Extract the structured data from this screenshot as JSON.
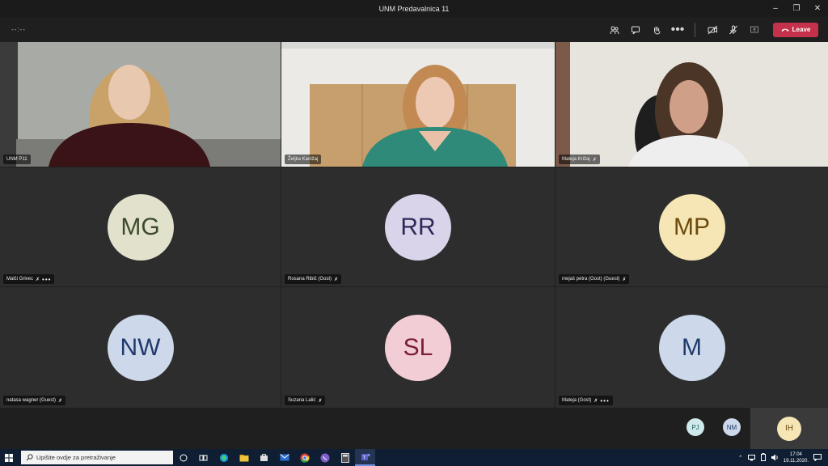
{
  "window": {
    "title": "UNM Predavalnica 11"
  },
  "toolbar": {
    "timer": "--:--",
    "leave_label": "Leave"
  },
  "tiles": [
    {
      "name": "UNM P11",
      "type": "video"
    },
    {
      "name": "Željka Kanižaj",
      "type": "video"
    },
    {
      "name": "Mateja Križaj",
      "type": "video"
    },
    {
      "name": "Malči Grivec",
      "initials": "MG",
      "bg": "#e2e2cc",
      "fg": "#3b4a2a"
    },
    {
      "name": "Rosana Ribič (Gost)",
      "initials": "RR",
      "bg": "#d9d4ea",
      "fg": "#2f2a5a"
    },
    {
      "name": "mejaš petra (Gost) (Guest)",
      "initials": "MP",
      "bg": "#f6e6b6",
      "fg": "#6b4a0c"
    },
    {
      "name": "natasa wagner (Guest)",
      "initials": "NW",
      "bg": "#cdd9ea",
      "fg": "#1f3a6b"
    },
    {
      "name": "Suzana Lalić",
      "initials": "SL",
      "bg": "#f3cdd6",
      "fg": "#7a1e35"
    },
    {
      "name": "Mateja (Gost)",
      "initials": "M",
      "bg": "#cdd9ea",
      "fg": "#1f3a6b"
    }
  ],
  "mini_participants": [
    {
      "initials": "PJ",
      "bg": "#cfe9ea",
      "fg": "#1d5b5f"
    },
    {
      "initials": "NM",
      "bg": "#cdd9ea",
      "fg": "#1f3a6b"
    }
  ],
  "self_view": {
    "initials": "IH",
    "bg": "#f6e6b6",
    "fg": "#6b4a0c"
  },
  "taskbar": {
    "search_placeholder": "Upišite ovdje za pretraživanje",
    "time": "17:04",
    "date": "19.11.2020."
  }
}
